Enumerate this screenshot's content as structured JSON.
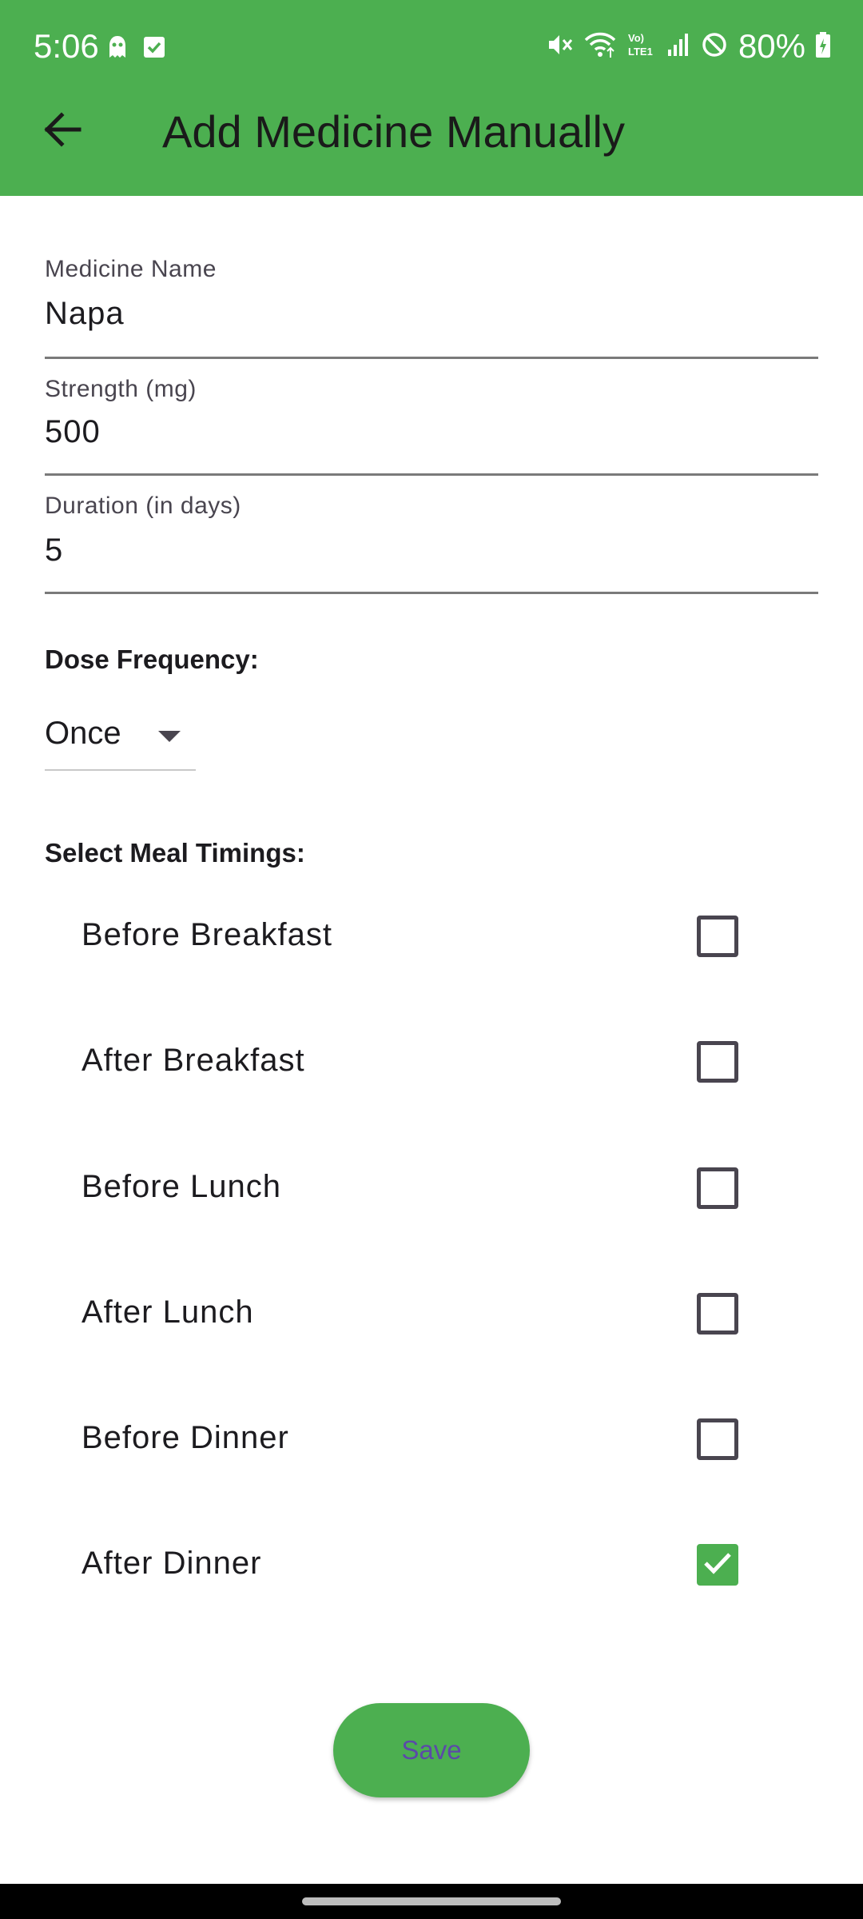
{
  "status_bar": {
    "time": "5:06",
    "battery": "80%",
    "icons": [
      "ghost-icon",
      "check-square-icon",
      "mute-icon",
      "wifi-icon",
      "volte-icon",
      "signal-icon",
      "dnd-icon",
      "battery-icon"
    ]
  },
  "app_bar": {
    "back_icon": "arrow-left-icon",
    "title": "Add Medicine Manually"
  },
  "form": {
    "medicine_name": {
      "label": "Medicine Name",
      "value": "Napa"
    },
    "strength": {
      "label": "Strength (mg)",
      "value": "500"
    },
    "duration": {
      "label": "Duration (in days)",
      "value": "5"
    }
  },
  "dose_frequency": {
    "title": "Dose Frequency:",
    "selected": "Once"
  },
  "meal_timings": {
    "title": "Select Meal Timings:",
    "items": [
      {
        "label": "Before Breakfast",
        "checked": false
      },
      {
        "label": "After Breakfast",
        "checked": false
      },
      {
        "label": "Before Lunch",
        "checked": false
      },
      {
        "label": "After Lunch",
        "checked": false
      },
      {
        "label": "Before Dinner",
        "checked": false
      },
      {
        "label": "After Dinner",
        "checked": true
      }
    ]
  },
  "save_button": {
    "label": "Save"
  },
  "colors": {
    "primary": "#4caf50",
    "save_text": "#5b4aa8"
  }
}
